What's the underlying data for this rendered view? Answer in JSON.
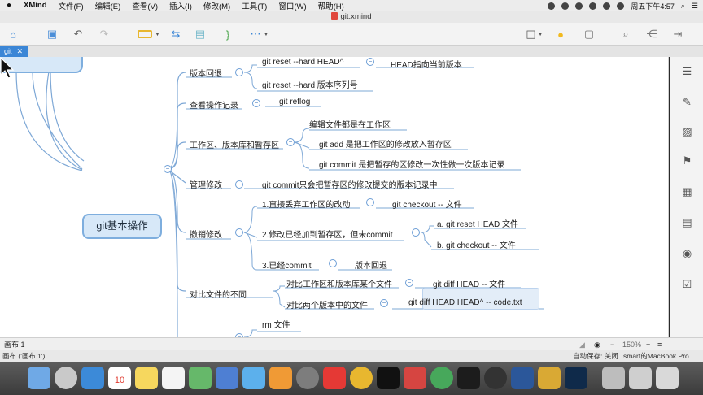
{
  "menubar": {
    "app": "XMind",
    "items": [
      "文件(F)",
      "编辑(E)",
      "查看(V)",
      "插入(I)",
      "修改(M)",
      "工具(T)",
      "窗口(W)",
      "帮助(H)"
    ],
    "clock": "周五下午4:57"
  },
  "window": {
    "title": "git.xmind"
  },
  "tabs": [
    {
      "label": "git"
    }
  ],
  "mindmap": {
    "central": "git基本操作",
    "branches": [
      {
        "label": "版本回退",
        "children": [
          {
            "label": "git reset --hard HEAD^",
            "note": "HEAD指向当前版本"
          },
          {
            "label": "git reset --hard 版本序列号"
          }
        ]
      },
      {
        "label": "查看操作记录",
        "children": [
          {
            "label": "git reflog"
          }
        ]
      },
      {
        "label": "工作区、版本库和暂存区",
        "children": [
          {
            "label": "编辑文件都是在工作区"
          },
          {
            "label": "git add 是把工作区的修改放入暂存区"
          },
          {
            "label": "git commit 是把暂存的区修改一次性做一次版本记录"
          }
        ]
      },
      {
        "label": "管理修改",
        "children": [
          {
            "label": "git commit只会把暂存区的修改提交的版本记录中"
          }
        ]
      },
      {
        "label": "撤销修改",
        "children": [
          {
            "label": "1.直接丢弃工作区的改动",
            "note": "git checkout -- 文件"
          },
          {
            "label": "2.修改已经加到暂存区，但未commit",
            "sub": [
              "a. git reset HEAD 文件",
              "b. git checkout -- 文件"
            ]
          },
          {
            "label": "3.已经commit",
            "note": "版本回退"
          }
        ]
      },
      {
        "label": "对比文件的不同",
        "children": [
          {
            "label": "对比工作区和版本库某个文件",
            "note": "git diff HEAD -- 文件"
          },
          {
            "label": "对比两个版本中的文件",
            "note": "git diff HEAD HEAD^ -- code.txt"
          }
        ]
      },
      {
        "label": "",
        "children": [
          {
            "label": "rm 文件"
          }
        ]
      }
    ]
  },
  "status": {
    "sheet": "画布 1",
    "zoom": "150%",
    "selection": "画布 ('画布 1')",
    "autosave": "自动保存: 关闭",
    "user": "smart的MacBook Pro"
  },
  "dock": {
    "calendar_day": "10"
  }
}
